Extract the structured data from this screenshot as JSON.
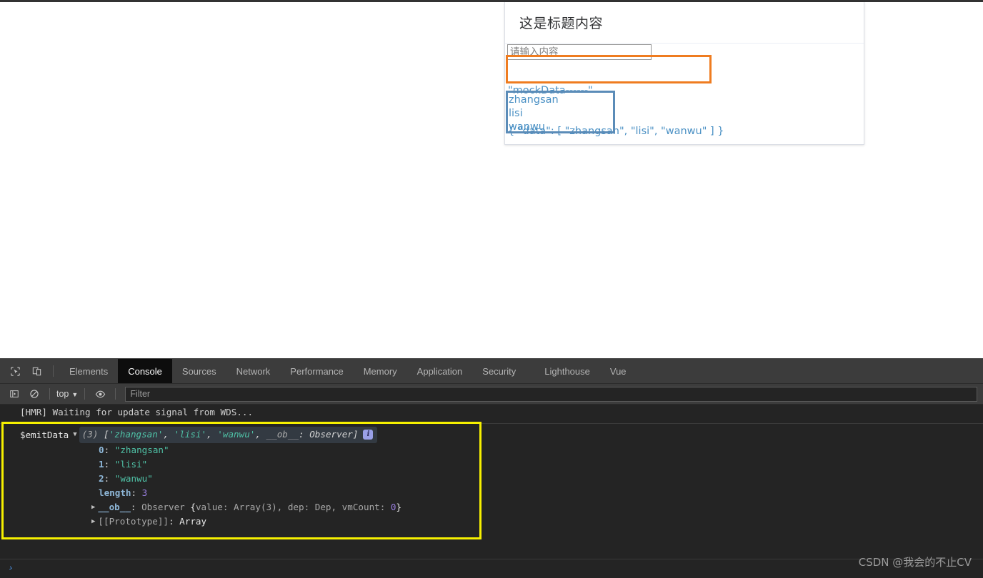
{
  "page": {
    "card": {
      "title": "这是标题内容",
      "input": {
        "value": "",
        "placeholder": "请输入内容"
      },
      "mock_line1": "\"mockData------\"",
      "mock_line2": "{ \"data\": [ \"zhangsan\", \"lisi\", \"wanwu\" ] }",
      "list": [
        "zhangsan",
        "lisi",
        "wanwu"
      ]
    },
    "highlight_orange_color": "#ef7c20",
    "highlight_blue_color": "#5b8cb8"
  },
  "devtools": {
    "icons": {
      "inspect": "inspect-cursor-icon",
      "device": "device-toggle-icon"
    },
    "tabs": [
      {
        "label": "Elements",
        "active": false
      },
      {
        "label": "Console",
        "active": true
      },
      {
        "label": "Sources",
        "active": false
      },
      {
        "label": "Network",
        "active": false
      },
      {
        "label": "Performance",
        "active": false
      },
      {
        "label": "Memory",
        "active": false
      },
      {
        "label": "Application",
        "active": false
      },
      {
        "label": "Security",
        "active": false
      },
      {
        "label": "Lighthouse",
        "active": false
      },
      {
        "label": "Vue",
        "active": false
      }
    ],
    "console_toolbar": {
      "sidebar_icon": "console-sidebar-icon",
      "clear_icon": "clear-console-icon",
      "context": "top",
      "caret": "▼",
      "eye_icon": "live-expression-eye-icon",
      "filter": {
        "value": "",
        "placeholder": "Filter"
      }
    },
    "console": {
      "hmr_message": "[HMR] Waiting for update signal from WDS...",
      "group": {
        "label": "$emitData",
        "toggle": "▼",
        "summary": {
          "count": "(3)",
          "open": "[",
          "items": [
            "'zhangsan'",
            "'lisi'",
            "'wanwu'"
          ],
          "separator": ", ",
          "observer_key": "__ob__",
          "observer_val": "Observer",
          "close": "]"
        },
        "info_badge": "i",
        "entries": [
          {
            "key": "0",
            "value": "\"zhangsan\"",
            "kind": "string"
          },
          {
            "key": "1",
            "value": "\"lisi\"",
            "kind": "string"
          },
          {
            "key": "2",
            "value": "\"wanwu\"",
            "kind": "string"
          },
          {
            "key": "length",
            "value": "3",
            "kind": "number"
          }
        ],
        "ob_row": {
          "toggle": "▶",
          "key": "__ob__",
          "type": "Observer",
          "detail_open": "{",
          "detail": "value: Array(3), dep: Dep, vmCount: ",
          "detail_num": "0",
          "detail_close": "}"
        },
        "proto_row": {
          "toggle": "▶",
          "key": "[[Prototype]]",
          "value": "Array"
        }
      },
      "prompt": "›"
    },
    "highlight_yellow_color": "#f6f000"
  },
  "watermark": "CSDN @我会的不止CV"
}
